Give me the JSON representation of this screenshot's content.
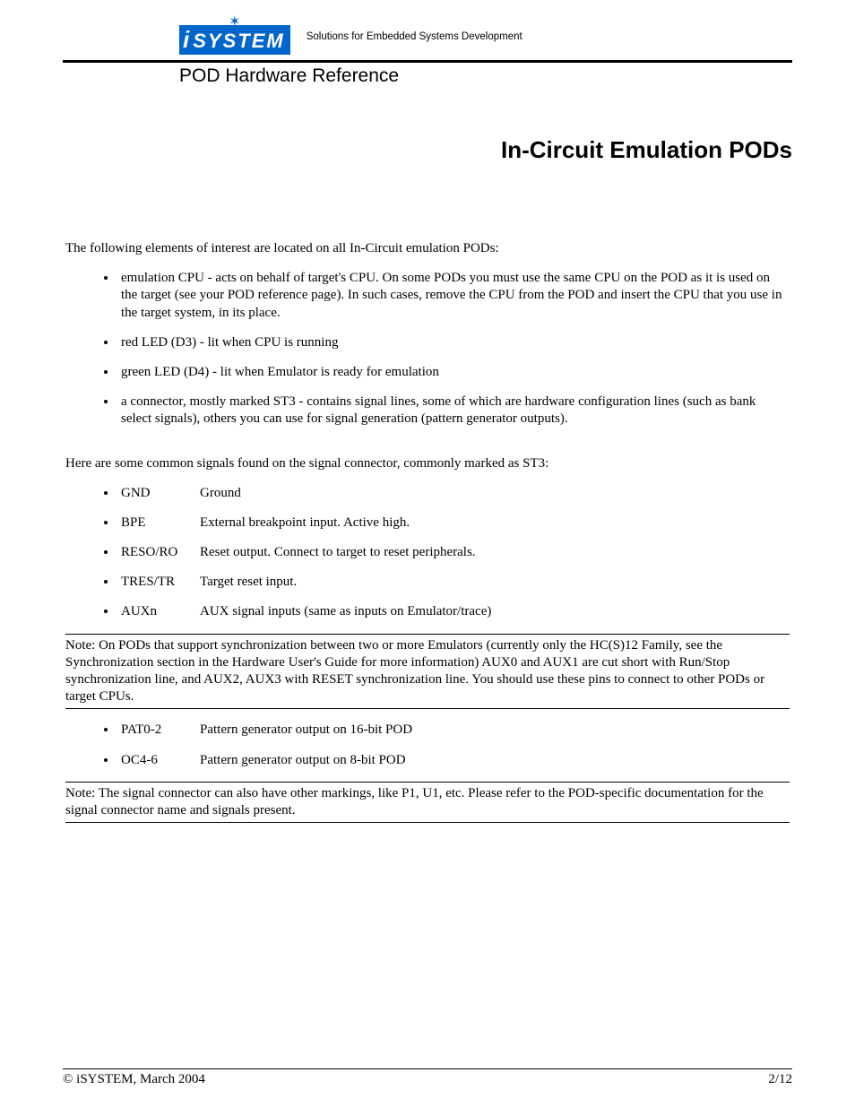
{
  "header": {
    "logo_text": "SYSTEM",
    "logo_i": "i",
    "tagline": "Solutions for Embedded Systems Development",
    "subtitle": "POD Hardware Reference"
  },
  "title": "In-Circuit Emulation PODs",
  "intro": "The following elements of interest are located on all In-Circuit emulation PODs:",
  "elements": [
    "emulation CPU - acts on behalf of target's CPU. On some PODs you must use the same CPU on the POD as it is used on the target (see your POD reference page). In such cases, remove the CPU from the POD and insert the CPU that you use in the target system, in its place.",
    "red LED (D3) - lit when CPU is running",
    "green LED (D4) - lit when Emulator is ready for emulation",
    "a connector, mostly marked ST3 - contains signal lines, some of which are hardware configuration lines (such as bank select signals), others you can use for signal generation (pattern generator outputs)."
  ],
  "signals_intro": "Here are some common signals found on the signal connector, commonly marked as ST3:",
  "signals1": [
    {
      "name": "GND",
      "desc": "Ground"
    },
    {
      "name": "BPE",
      "desc": "External breakpoint input. Active high."
    },
    {
      "name": "RESO/RO",
      "desc": "Reset output. Connect to target to reset peripherals."
    },
    {
      "name": "TRES/TR",
      "desc": "Target reset input."
    },
    {
      "name": "AUXn",
      "desc": "AUX signal inputs (same as inputs on Emulator/trace)"
    }
  ],
  "note1": "Note: On PODs that support synchronization between two or more Emulators (currently only the HC(S)12 Family, see the Synchronization section in the Hardware User's Guide for more information) AUX0 and AUX1 are cut short with Run/Stop synchronization line, and AUX2, AUX3 with RESET synchronization line. You should use these pins to connect to other PODs or target CPUs.",
  "signals2": [
    {
      "name": "PAT0-2",
      "desc": "Pattern generator output on 16-bit POD"
    },
    {
      "name": "OC4-6",
      "desc": "Pattern generator output on 8-bit POD"
    }
  ],
  "note2": "Note: The signal connector can also have other markings, like P1, U1, etc. Please refer to the POD-specific documentation for the signal connector name and signals present.",
  "footer": {
    "copyright": "© iSYSTEM, March 2004",
    "page": "2/12"
  }
}
